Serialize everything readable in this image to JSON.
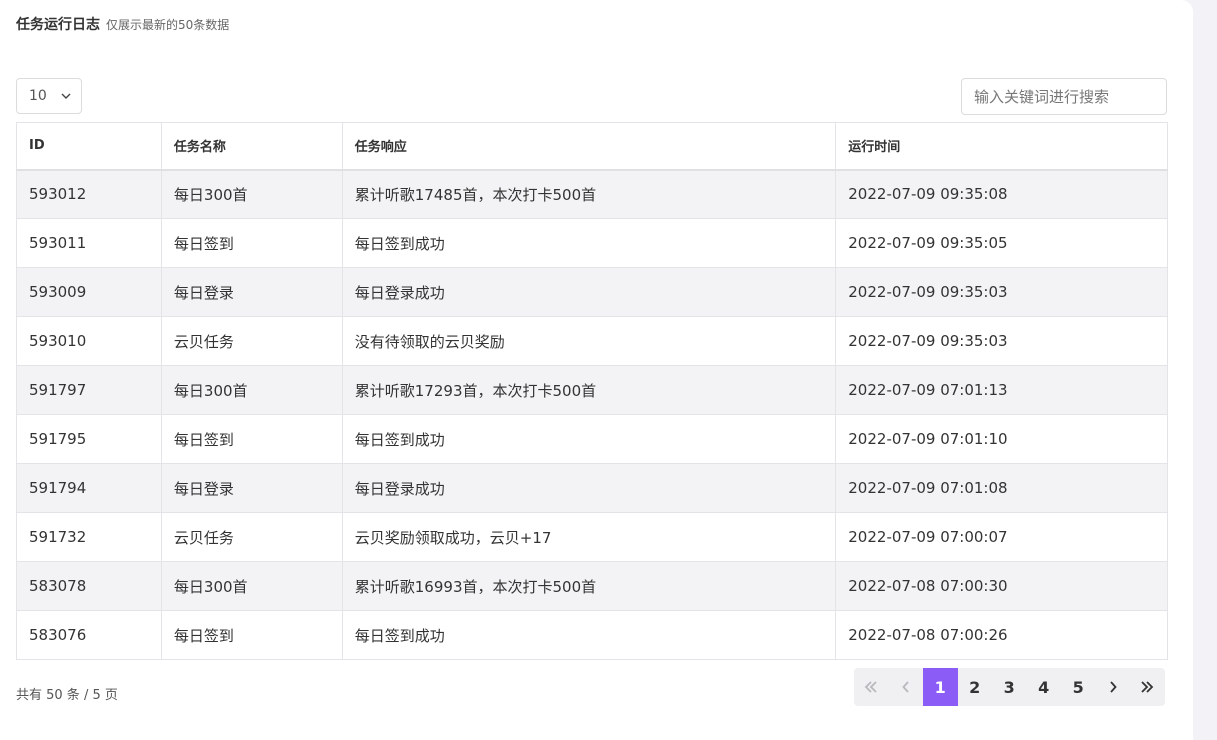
{
  "header": {
    "title": "任务运行日志",
    "subtitle": "仅展示最新的50条数据"
  },
  "page_size": {
    "selected": "10"
  },
  "search": {
    "placeholder": "输入关键词进行搜索"
  },
  "table": {
    "columns": [
      "ID",
      "任务名称",
      "任务响应",
      "运行时间"
    ],
    "rows": [
      [
        "593012",
        "每日300首",
        "累计听歌17485首，本次打卡500首",
        "2022-07-09 09:35:08"
      ],
      [
        "593011",
        "每日签到",
        "每日签到成功",
        "2022-07-09 09:35:05"
      ],
      [
        "593009",
        "每日登录",
        "每日登录成功",
        "2022-07-09 09:35:03"
      ],
      [
        "593010",
        "云贝任务",
        "没有待领取的云贝奖励",
        "2022-07-09 09:35:03"
      ],
      [
        "591797",
        "每日300首",
        "累计听歌17293首，本次打卡500首",
        "2022-07-09 07:01:13"
      ],
      [
        "591795",
        "每日签到",
        "每日签到成功",
        "2022-07-09 07:01:10"
      ],
      [
        "591794",
        "每日登录",
        "每日登录成功",
        "2022-07-09 07:01:08"
      ],
      [
        "591732",
        "云贝任务",
        "云贝奖励领取成功，云贝+17",
        "2022-07-09 07:00:07"
      ],
      [
        "583078",
        "每日300首",
        "累计听歌16993首，本次打卡500首",
        "2022-07-08 07:00:30"
      ],
      [
        "583076",
        "每日签到",
        "每日签到成功",
        "2022-07-08 07:00:26"
      ]
    ]
  },
  "footer": {
    "summary": "共有 50 条 / 5 页"
  },
  "pagination": {
    "pages": [
      "1",
      "2",
      "3",
      "4",
      "5"
    ],
    "current": "1",
    "first_icon": "double-chevron-left-icon",
    "prev_icon": "chevron-left-icon",
    "next_icon": "chevron-right-icon",
    "last_icon": "double-chevron-right-icon"
  },
  "colors": {
    "accent": "#8b5cf6",
    "stripe": "#f3f3f6",
    "border": "#e4e4e8"
  }
}
